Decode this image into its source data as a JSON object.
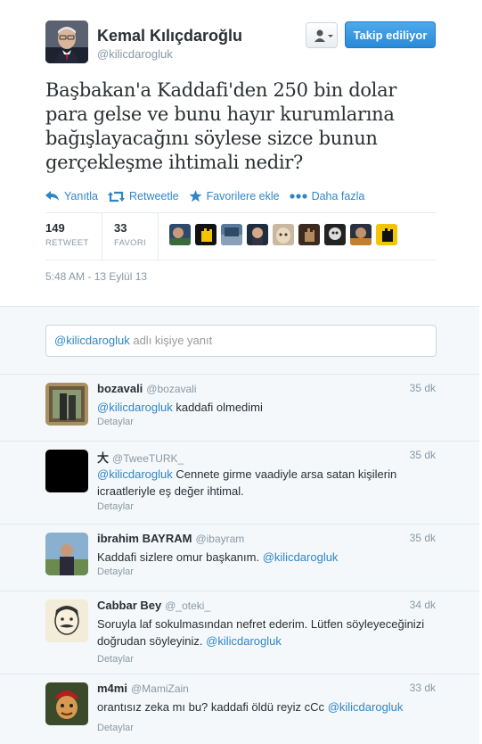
{
  "profile": {
    "name": "Kemal Kılıçdaroğlu",
    "handle": "@kilicdarogluk",
    "follow_label": "Takip ediliyor"
  },
  "tweet": {
    "text": "Başbakan'a Kaddafi'den 250 bin dolar para gelse ve bunu hayır kurumlarına bağışlayacağını söylese sizce bunun gerçekleşme ihtimali nedir?",
    "actions": {
      "reply": "Yanıtla",
      "retweet": "Retweetle",
      "favorite": "Favorilere ekle",
      "more": "Daha fazla"
    },
    "retweets": "149",
    "retweets_label": "RETWEET",
    "favorites": "33",
    "favorites_label": "FAVORI",
    "timestamp": "5:48 AM - 13 Eylül 13"
  },
  "reply_box": {
    "mention": "@kilicdarogluk",
    "placeholder": " adlı kişiye yanıt"
  },
  "colors": {
    "link": "#2f86c7",
    "follow_button": "#2a8ad8",
    "background_light": "#f5f8fa"
  },
  "replies": [
    {
      "name": "bozavali",
      "handle": "@bozavali",
      "time": "35 dk",
      "mention": "@kilicdarogluk",
      "text": " kaddafi olmedimi",
      "details": "Detaylar"
    },
    {
      "name": "大",
      "handle": "@TweeTURK_",
      "time": "35 dk",
      "mention": "@kilicdarogluk",
      "text": " Cennete girme vaadiyle arsa satan kişilerin icraatleriyle eş değer ihtimal.",
      "details": "Detaylar"
    },
    {
      "name": "ibrahim BAYRAM",
      "handle": "@ibayram",
      "time": "35 dk",
      "text": "Kaddafi sizlere omur başkanım. ",
      "mention": "@kilicdarogluk",
      "details": "Detaylar"
    },
    {
      "name": "Cabbar Bey",
      "handle": "@_oteki_",
      "time": "34 dk",
      "text": "Soruyla laf sokulmasından nefret ederim. Lütfen söyleyeceğinizi doğrudan söyleyiniz. ",
      "mention": "@kilicdarogluk",
      "details": "Detaylar"
    },
    {
      "name": "m4mi",
      "handle": "@MamiZain",
      "time": "33 dk",
      "text": "orantısız zeka mı bu? kaddafi öldü reyiz cCc ",
      "mention": "@kilicdarogluk",
      "details": "Detaylar"
    }
  ]
}
